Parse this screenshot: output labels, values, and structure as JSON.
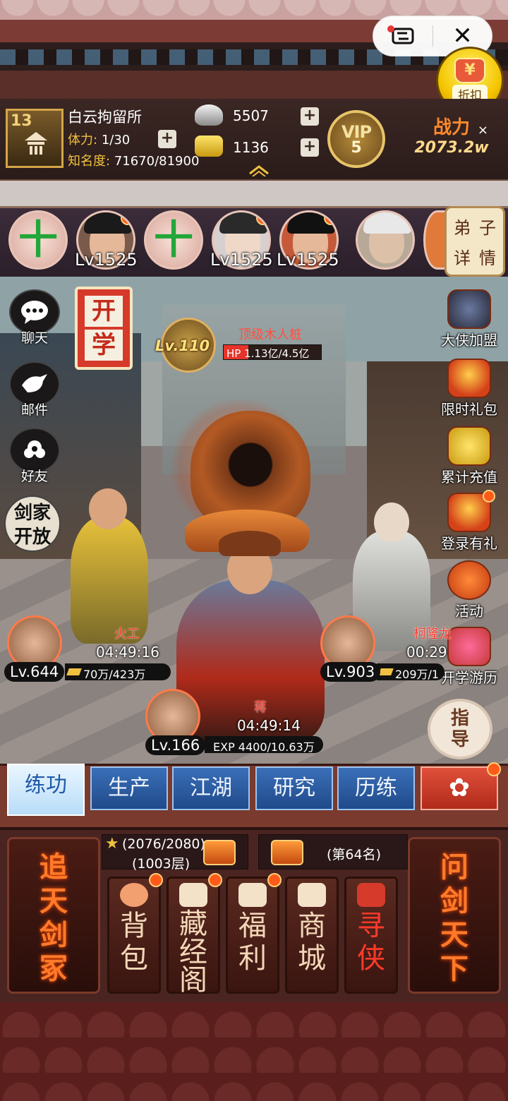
{
  "top_capsule": {
    "close_symbol": "✕"
  },
  "discount": {
    "label": "折扣",
    "symbol": "¥"
  },
  "player": {
    "level": "13",
    "name": "白云拘留所",
    "stamina_label": "体力:",
    "stamina_value": "1/30",
    "fame_label": "知名度:",
    "fame_value": "71670/81900",
    "silver": "5507",
    "gold": "1136",
    "vip_text": "VIP",
    "vip_level": "5",
    "power_label": "战力",
    "power_value": "2073.2w"
  },
  "disciples": {
    "slots": [
      {
        "type": "add",
        "level": ""
      },
      {
        "type": "hero",
        "level": "Lv1525"
      },
      {
        "type": "add",
        "level": ""
      },
      {
        "type": "hero",
        "level": "Lv1525"
      },
      {
        "type": "hero",
        "level": "Lv1525"
      },
      {
        "type": "hero",
        "level": ""
      }
    ],
    "detail_tab": [
      "弟",
      "子",
      "详",
      "情"
    ]
  },
  "left_menu": [
    {
      "label": "聊天",
      "icon": "chat-bubble-icon"
    },
    {
      "label": "邮件",
      "icon": "dove-icon"
    },
    {
      "label": "好友",
      "icon": "flower-icon"
    }
  ],
  "sword_family": "剑家开放",
  "open_school": [
    "开",
    "学"
  ],
  "boss": {
    "level": "Lv.110",
    "name": "顶级木人桩",
    "hp_text": "HP 1.13亿/4.5亿",
    "hp_fraction": 0.25
  },
  "right_menu": [
    {
      "label": "大侠加盟",
      "icon": "warrior-icon"
    },
    {
      "label": "限时礼包",
      "icon": "gift-pack-icon"
    },
    {
      "label": "累计充值",
      "icon": "money-bag-icon"
    },
    {
      "label": "登录有礼",
      "icon": "treasure-chest-icon"
    },
    {
      "label": "活动",
      "icon": "lantern-icon"
    },
    {
      "label": "开学游历",
      "icon": "scroll-icon"
    }
  ],
  "workers": {
    "left": {
      "name": "火工",
      "time": "04:49:16",
      "level": "Lv.644",
      "bar": "70万/423万"
    },
    "right": {
      "name": "柯隆龙",
      "time": "00:29",
      "level": "Lv.903",
      "bar": "209万/1"
    },
    "center": {
      "name": "蒋",
      "time": "04:49:14",
      "level": "Lv.166",
      "bar": "EXP 4400/10.63万"
    }
  },
  "guide": [
    "指",
    "导"
  ],
  "tabs": [
    {
      "label": "练功",
      "active": true
    },
    {
      "label": "生产",
      "active": false
    },
    {
      "label": "江湖",
      "active": false
    },
    {
      "label": "研究",
      "active": false
    },
    {
      "label": "历练",
      "active": false
    }
  ],
  "bottom": {
    "left_pillar": "追天剑冢",
    "right_pillar": "问剑天下",
    "stars": "(2076/2080)",
    "floor": "(1003层)",
    "rank": "(第64名)",
    "menus": [
      {
        "label": "背包",
        "icon": "peach-bag-icon"
      },
      {
        "label": "藏经阁",
        "icon": "pavilion-icon"
      },
      {
        "label": "福利",
        "icon": "coin-icon"
      },
      {
        "label": "商城",
        "icon": "shop-icon"
      },
      {
        "label": "寻侠",
        "icon": "red-envelope-icon"
      }
    ]
  },
  "colors": {
    "accent_red": "#e53935",
    "tab_blue": "#2a5aa0",
    "gold": "#f0c040"
  }
}
